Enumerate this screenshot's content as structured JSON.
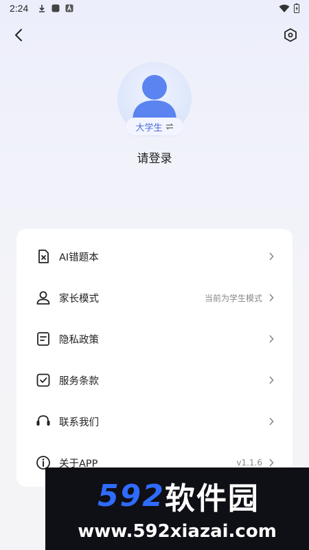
{
  "status_bar": {
    "time": "2:24",
    "icons": [
      "download-icon",
      "square-icon",
      "a-badge-icon",
      "wifi-icon",
      "battery-icon"
    ]
  },
  "nav": {
    "back_icon": "back-arrow-icon",
    "settings_icon": "hex-gear-icon"
  },
  "profile": {
    "role": "大学生",
    "switch_icon": "swap-icon",
    "login_text": "请登录"
  },
  "menu": {
    "items": [
      {
        "label": "AI错题本",
        "value": "",
        "icon": "error-book-icon"
      },
      {
        "label": "家长模式",
        "value": "当前为学生模式",
        "icon": "person-icon"
      },
      {
        "label": "隐私政策",
        "value": "",
        "icon": "document-icon"
      },
      {
        "label": "服务条款",
        "value": "",
        "icon": "checkbox-icon"
      },
      {
        "label": "联系我们",
        "value": "",
        "icon": "headset-icon"
      },
      {
        "label": "关于APP",
        "value": "v1.1.6",
        "icon": "info-icon"
      }
    ]
  },
  "watermark": {
    "logo_num": "592",
    "logo_cn": "软件园",
    "url": "www.592xiazai.com"
  },
  "colors": {
    "accent": "#4a6ad8",
    "avatar": "#5b84f0",
    "watermark_blue": "#2f6bff"
  }
}
